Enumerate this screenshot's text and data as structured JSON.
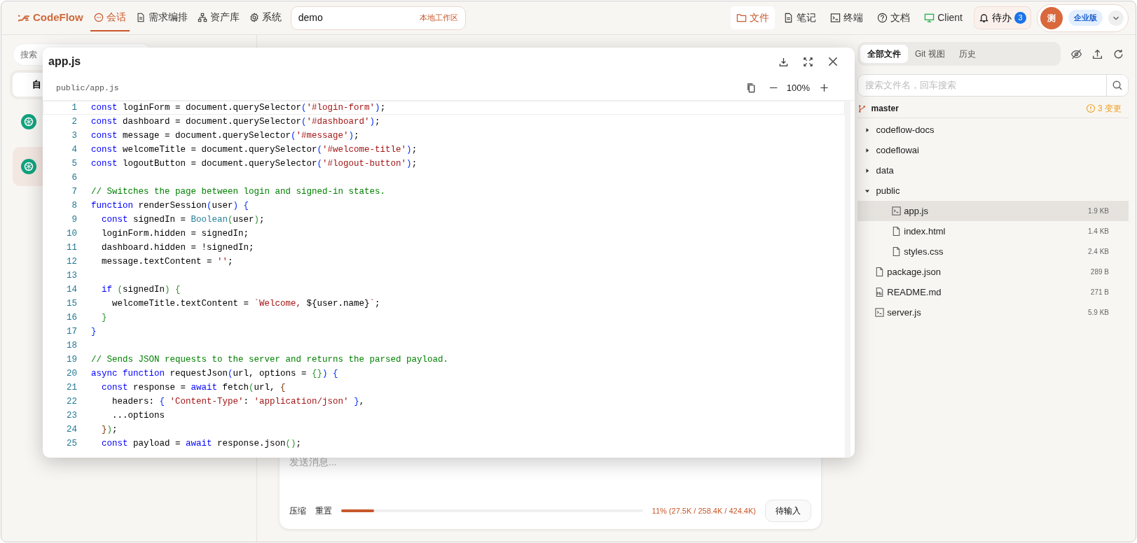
{
  "top_nav": {
    "logo": "CodeFlow",
    "tabs": [
      {
        "label": "会话",
        "selected": true
      },
      {
        "label": "需求编排",
        "selected": false
      },
      {
        "label": "资产库",
        "selected": false
      },
      {
        "label": "系统",
        "selected": false
      }
    ],
    "workspace": {
      "value": "demo",
      "tag": "本地工作区"
    },
    "tools": [
      {
        "label": "文件",
        "selected": true
      },
      {
        "label": "笔记",
        "selected": false
      },
      {
        "label": "终端",
        "selected": false
      },
      {
        "label": "文档",
        "selected": false
      },
      {
        "label": "Client",
        "selected": false
      }
    ],
    "todo": {
      "label": "待办",
      "count": "3"
    },
    "avatar": "测",
    "plan": "企业版"
  },
  "left_panel": {
    "search_placeholder": "搜索",
    "tab": "自",
    "sessions": [
      {
        "selected": false
      },
      {
        "selected": true
      }
    ]
  },
  "chat": {
    "input_placeholder": "发送消息...",
    "actions": [
      "压缩",
      "重置"
    ],
    "context": {
      "level": 0.11,
      "reading": "11% (27.5K / 258.4K / 424.4K)"
    },
    "send_button": "待输入"
  },
  "file_panel": {
    "tabs": [
      {
        "label": "全部文件",
        "selected": true
      },
      {
        "label": "Git 视图",
        "selected": false
      },
      {
        "label": "历史",
        "selected": false
      }
    ],
    "search_placeholder": "搜索文件名，回车搜索",
    "branch": "master",
    "changes": "3 变更",
    "tree": [
      {
        "kind": "folder",
        "name": "codeflow-docs",
        "expanded": false
      },
      {
        "kind": "folder",
        "name": "codeflowai",
        "expanded": false
      },
      {
        "kind": "folder",
        "name": "data",
        "expanded": false
      },
      {
        "kind": "folder",
        "name": "public",
        "expanded": true,
        "children": [
          {
            "kind": "script",
            "name": "app.js",
            "size": "1.9 KB",
            "selected": true
          },
          {
            "kind": "page",
            "name": "index.html",
            "size": "1.4 KB",
            "selected": false
          },
          {
            "kind": "page",
            "name": "styles.css",
            "size": "2.4 KB",
            "selected": false
          }
        ]
      },
      {
        "kind": "page",
        "name": "package.json",
        "size": "289 B",
        "selected": false
      },
      {
        "kind": "markdown",
        "name": "README.md",
        "size": "271 B",
        "selected": false
      },
      {
        "kind": "script",
        "name": "server.js",
        "size": "5.9 KB",
        "selected": false
      }
    ]
  },
  "viewer": {
    "title": "app.js",
    "path": "public/app.js",
    "zoom": "100%",
    "lines": [
      {
        "number": "1",
        "tokens": [
          {
            "kind": "kw",
            "text": "const"
          },
          {
            "kind": "txt",
            "text": " loginForm = document.querySelector"
          },
          {
            "kind": "br",
            "text": "("
          },
          {
            "kind": "str",
            "text": "'#login-form'"
          },
          {
            "kind": "br",
            "text": ")"
          },
          {
            "kind": "txt",
            "text": ";"
          }
        ]
      },
      {
        "number": "2",
        "tokens": [
          {
            "kind": "kw",
            "text": "const"
          },
          {
            "kind": "txt",
            "text": " dashboard = document.querySelector"
          },
          {
            "kind": "br",
            "text": "("
          },
          {
            "kind": "str",
            "text": "'#dashboard'"
          },
          {
            "kind": "br",
            "text": ")"
          },
          {
            "kind": "txt",
            "text": ";"
          }
        ]
      },
      {
        "number": "3",
        "tokens": [
          {
            "kind": "kw",
            "text": "const"
          },
          {
            "kind": "txt",
            "text": " message = document.querySelector"
          },
          {
            "kind": "br",
            "text": "("
          },
          {
            "kind": "str",
            "text": "'#message'"
          },
          {
            "kind": "br",
            "text": ")"
          },
          {
            "kind": "txt",
            "text": ";"
          }
        ]
      },
      {
        "number": "4",
        "tokens": [
          {
            "kind": "kw",
            "text": "const"
          },
          {
            "kind": "txt",
            "text": " welcomeTitle = document.querySelector"
          },
          {
            "kind": "br",
            "text": "("
          },
          {
            "kind": "str",
            "text": "'#welcome-title'"
          },
          {
            "kind": "br",
            "text": ")"
          },
          {
            "kind": "txt",
            "text": ";"
          }
        ]
      },
      {
        "number": "5",
        "tokens": [
          {
            "kind": "kw",
            "text": "const"
          },
          {
            "kind": "txt",
            "text": " logoutButton = document.querySelector"
          },
          {
            "kind": "br",
            "text": "("
          },
          {
            "kind": "str",
            "text": "'#logout-button'"
          },
          {
            "kind": "br",
            "text": ")"
          },
          {
            "kind": "txt",
            "text": ";"
          }
        ]
      },
      {
        "number": "6"
      },
      {
        "number": "7",
        "tokens": [
          {
            "kind": "com",
            "text": "// Switches the page between login and signed-in states."
          }
        ]
      },
      {
        "number": "8",
        "tokens": [
          {
            "kind": "kw",
            "text": "function"
          },
          {
            "kind": "txt",
            "text": " renderSession"
          },
          {
            "kind": "br",
            "text": "("
          },
          {
            "kind": "txt",
            "text": "user"
          },
          {
            "kind": "br",
            "text": ") {"
          }
        ]
      },
      {
        "number": "9",
        "tokens": [
          {
            "kind": "kw",
            "text": "  const"
          },
          {
            "kind": "txt",
            "text": " signedIn = "
          },
          {
            "kind": "type",
            "text": "Boolean"
          },
          {
            "kind": "br2",
            "text": "("
          },
          {
            "kind": "txt",
            "text": "user"
          },
          {
            "kind": "br2",
            "text": ")"
          },
          {
            "kind": "txt",
            "text": ";"
          }
        ]
      },
      {
        "number": "10",
        "tokens": [
          {
            "kind": "txt",
            "text": "  loginForm.hidden = signedIn;"
          }
        ]
      },
      {
        "number": "11",
        "tokens": [
          {
            "kind": "txt",
            "text": "  dashboard.hidden = !signedIn;"
          }
        ]
      },
      {
        "number": "12",
        "tokens": [
          {
            "kind": "txt",
            "text": "  message.textContent = "
          },
          {
            "kind": "str",
            "text": "''"
          },
          {
            "kind": "txt",
            "text": ";"
          }
        ]
      },
      {
        "number": "13"
      },
      {
        "number": "14",
        "tokens": [
          {
            "kind": "kw",
            "text": "  if"
          },
          {
            "kind": "br2",
            "text": " ("
          },
          {
            "kind": "txt",
            "text": "signedIn"
          },
          {
            "kind": "br2",
            "text": ") {"
          }
        ]
      },
      {
        "number": "15",
        "tokens": [
          {
            "kind": "txt",
            "text": "    welcomeTitle.textContent = "
          },
          {
            "kind": "str",
            "text": "`Welcome, "
          },
          {
            "kind": "txt",
            "text": "${user.name}"
          },
          {
            "kind": "str",
            "text": "`"
          },
          {
            "kind": "txt",
            "text": ";"
          }
        ]
      },
      {
        "number": "16",
        "tokens": [
          {
            "kind": "br2",
            "text": "  }"
          }
        ]
      },
      {
        "number": "17",
        "tokens": [
          {
            "kind": "br",
            "text": "}"
          }
        ]
      },
      {
        "number": "18"
      },
      {
        "number": "19",
        "tokens": [
          {
            "kind": "com",
            "text": "// Sends JSON requests to the server and returns the parsed payload."
          }
        ]
      },
      {
        "number": "20",
        "tokens": [
          {
            "kind": "kw",
            "text": "async function"
          },
          {
            "kind": "txt",
            "text": " requestJson"
          },
          {
            "kind": "br",
            "text": "("
          },
          {
            "kind": "txt",
            "text": "url, options = "
          },
          {
            "kind": "br2",
            "text": "{}"
          },
          {
            "kind": "br",
            "text": ") {"
          }
        ]
      },
      {
        "number": "21",
        "tokens": [
          {
            "kind": "kw",
            "text": "  const"
          },
          {
            "kind": "txt",
            "text": " response = "
          },
          {
            "kind": "kw",
            "text": "await"
          },
          {
            "kind": "txt",
            "text": " fetch"
          },
          {
            "kind": "br2",
            "text": "("
          },
          {
            "kind": "txt",
            "text": "url, "
          },
          {
            "kind": "br3",
            "text": "{"
          }
        ]
      },
      {
        "number": "22",
        "tokens": [
          {
            "kind": "txt",
            "text": "    headers: "
          },
          {
            "kind": "br",
            "text": "{ "
          },
          {
            "kind": "str",
            "text": "'Content-Type'"
          },
          {
            "kind": "txt",
            "text": ": "
          },
          {
            "kind": "str",
            "text": "'application/json'"
          },
          {
            "kind": "br",
            "text": " }"
          },
          {
            "kind": "txt",
            "text": ","
          }
        ]
      },
      {
        "number": "23",
        "tokens": [
          {
            "kind": "txt",
            "text": "    ...options"
          }
        ]
      },
      {
        "number": "24",
        "tokens": [
          {
            "kind": "br3",
            "text": "  }"
          },
          {
            "kind": "br2",
            "text": ")"
          },
          {
            "kind": "txt",
            "text": ";"
          }
        ]
      },
      {
        "number": "25",
        "tokens": [
          {
            "kind": "kw",
            "text": "  const"
          },
          {
            "kind": "txt",
            "text": " payload = "
          },
          {
            "kind": "kw",
            "text": "await"
          },
          {
            "kind": "txt",
            "text": " response.json"
          },
          {
            "kind": "br2",
            "text": "()"
          },
          {
            "kind": "txt",
            "text": ";"
          }
        ]
      }
    ]
  }
}
